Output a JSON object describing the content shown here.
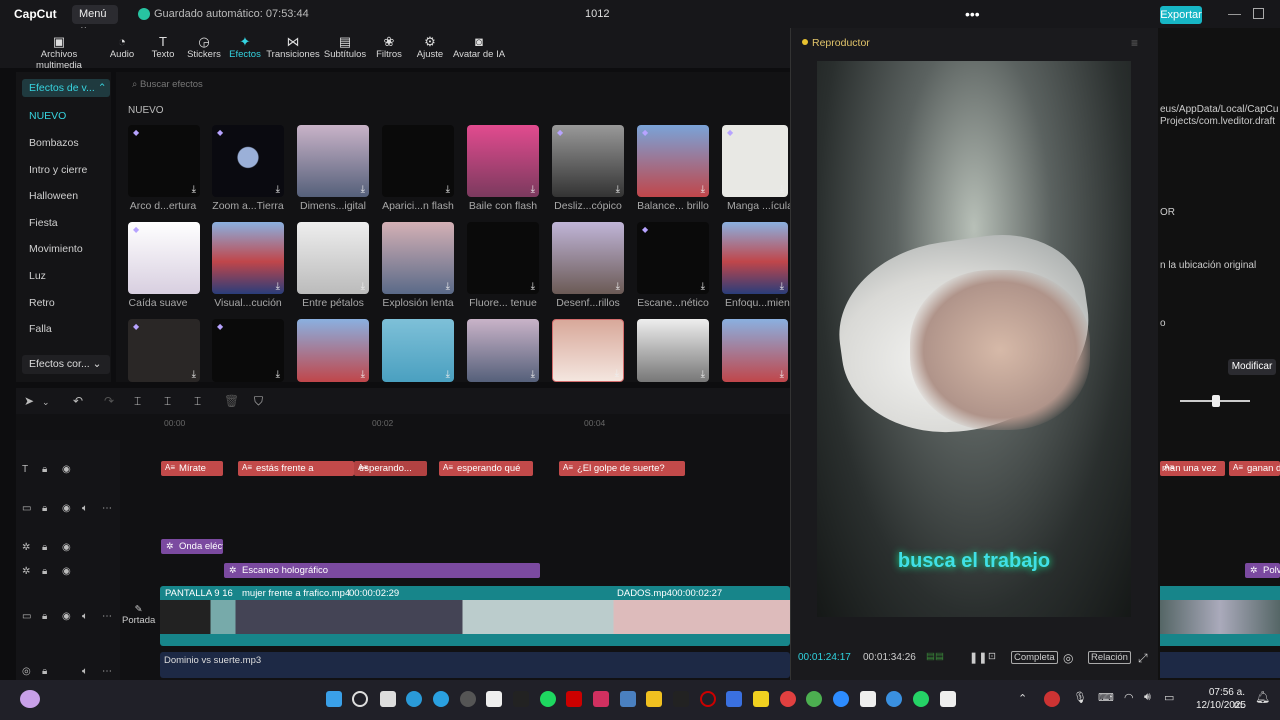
{
  "app": {
    "logo": "CapCut",
    "menu": "Menú",
    "autosave": "Guardado automático: 07:53:44",
    "project": "1012",
    "export": "Exportar"
  },
  "toolbar": {
    "items": [
      {
        "label": "Archivos multimedia",
        "icon": "media-icon"
      },
      {
        "label": "Audio",
        "icon": "audio-icon"
      },
      {
        "label": "Texto",
        "icon": "text-icon"
      },
      {
        "label": "Stickers",
        "icon": "sticker-icon"
      },
      {
        "label": "Efectos",
        "icon": "effects-icon"
      },
      {
        "label": "Transiciones",
        "icon": "transition-icon"
      },
      {
        "label": "Subtítulos",
        "icon": "subtitle-icon"
      },
      {
        "label": "Filtros",
        "icon": "filter-icon"
      },
      {
        "label": "Ajuste",
        "icon": "adjust-icon"
      },
      {
        "label": "Avatar de IA",
        "icon": "ai-avatar-icon"
      }
    ],
    "active": "Efectos"
  },
  "sidebar": {
    "header": "Efectos de v...",
    "items": [
      "NUEVO",
      "Bombazos",
      "Intro y cierre",
      "Halloween",
      "Fiesta",
      "Movimiento",
      "Luz",
      "Retro",
      "Falla"
    ],
    "footer": "Efectos cor..."
  },
  "effects": {
    "search_placeholder": "Buscar efectos",
    "section": "NUEVO",
    "row1": [
      "Arco d...ertura",
      "Zoom a...Tierra",
      "Dimens...igital",
      "Aparici...n flash",
      "Baile con flash",
      "Desliz...cópico",
      "Balance... brillo",
      "Manga ...ícula"
    ],
    "row2": [
      "Caída suave",
      "Visual...cución",
      "Entre pétalos",
      "Explosión lenta",
      "Fluore... tenue",
      "Desenf...rillos",
      "Escane...nético",
      "Enfoqu...mien"
    ]
  },
  "timeline": {
    "ruler": [
      "00:00",
      "00:02",
      "00:04"
    ],
    "text_clips": [
      "Mírate",
      "estás frente a",
      "esperando...",
      "esperando qué",
      "¿El golpe de suerte?"
    ],
    "fx_clips": [
      "Onda eléctr",
      "Escaneo holográfico"
    ],
    "video_clips": [
      {
        "name": "PANTALLA 9 16",
        "dur": ""
      },
      {
        "name": "mujer frente a frafico.mp4",
        "dur": "00:00:02:29"
      },
      {
        "name": "DADOS.mp4",
        "dur": "00:00:02:27"
      }
    ],
    "audio": "Dominio vs suerte.mp3",
    "portada": "Portada"
  },
  "player": {
    "title": "Reproductor",
    "caption": "busca el trabajo",
    "time_current": "00:01:24:17",
    "time_total": "00:01:34:26",
    "full": "Completa",
    "ratio": "Relación"
  },
  "right": {
    "path": "eus/AppData/Local/CapCu",
    "path2": "Projects/com.lveditor.draft",
    "or": "OR",
    "loc": "n la ubicación original",
    "o": "o",
    "modify": "Modificar",
    "clip1": "man una vez",
    "clip2": "ganan de",
    "clip3": "Polv"
  },
  "taskbar": {
    "time": "07:56 a. m.",
    "date": "12/10/2025"
  }
}
